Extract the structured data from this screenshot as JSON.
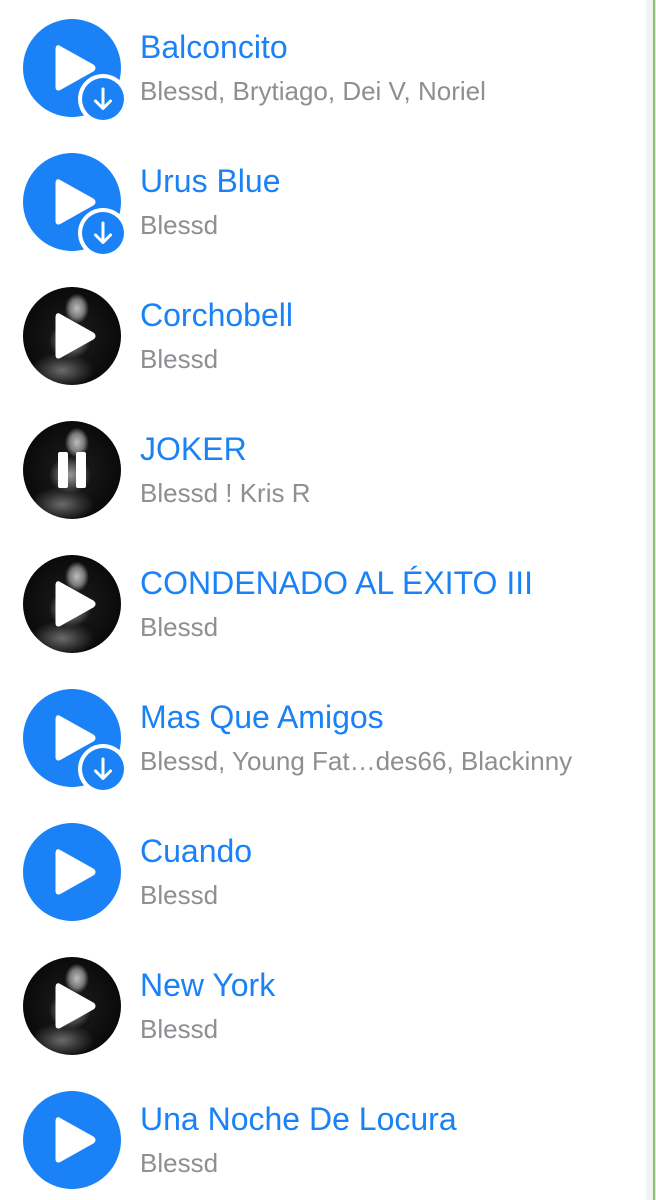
{
  "colors": {
    "accent": "#1a82f6",
    "subtitle": "#8e8e93",
    "background": "#ffffff"
  },
  "tracks": [
    {
      "title": "Balconcito",
      "artist": "Blessd, Brytiago, Dei V, Noriel",
      "cover": "blue",
      "state": "play-icon",
      "downloadable": true
    },
    {
      "title": "Urus Blue",
      "artist": "Blessd",
      "cover": "blue",
      "state": "play-icon",
      "downloadable": true
    },
    {
      "title": "Corchobell",
      "artist": "Blessd",
      "cover": "photo",
      "state": "play-icon",
      "downloadable": false
    },
    {
      "title": "JOKER",
      "artist": "Blessd ! Kris R",
      "cover": "photo",
      "state": "pause-icon",
      "downloadable": false
    },
    {
      "title": "CONDENADO AL ÉXITO III",
      "artist": "Blessd",
      "cover": "photo",
      "state": "play-icon",
      "downloadable": false
    },
    {
      "title": "Mas Que Amigos",
      "artist": "Blessd, Young Fat…des66, Blackinny",
      "cover": "blue",
      "state": "play-icon",
      "downloadable": true
    },
    {
      "title": "Cuando",
      "artist": "Blessd",
      "cover": "blue",
      "state": "play-icon",
      "downloadable": false
    },
    {
      "title": "New York",
      "artist": "Blessd",
      "cover": "photo",
      "state": "play-icon",
      "downloadable": false
    },
    {
      "title": "Una Noche De Locura",
      "artist": "Blessd",
      "cover": "blue",
      "state": "play-icon",
      "downloadable": false
    }
  ]
}
